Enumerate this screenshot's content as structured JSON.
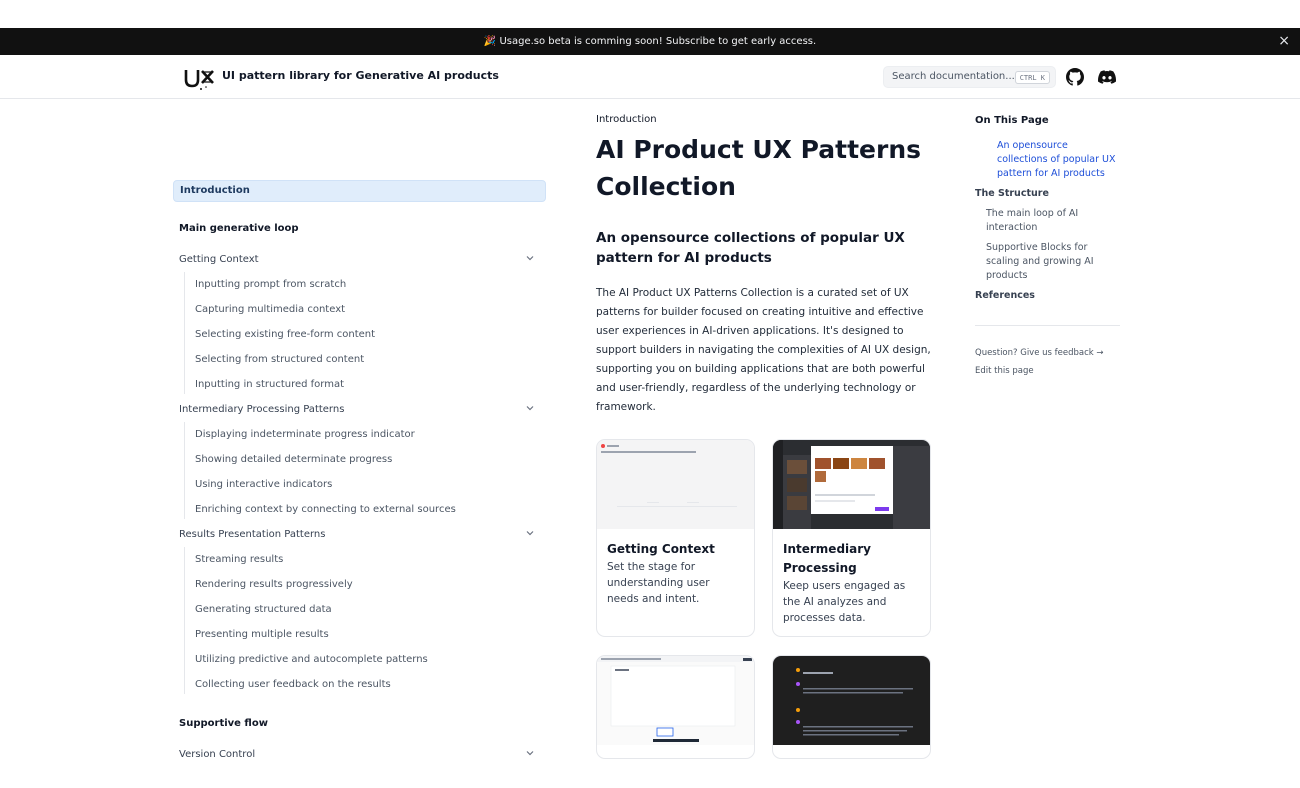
{
  "banner": {
    "text": "🎉 Usage.so beta is comming soon! Subscribe to get early access.",
    "close_label": "×"
  },
  "header": {
    "site_title": "UI pattern library for Generative AI products",
    "search_placeholder": "Search documentation...",
    "search_shortcut": "CTRL K",
    "icons": [
      "github-icon",
      "discord-icon"
    ]
  },
  "sidebar": {
    "active": "Introduction",
    "sections": [
      {
        "title": "Main generative loop",
        "groups": [
          {
            "label": "Getting Context",
            "items": [
              "Inputting prompt from scratch",
              "Capturing multimedia context",
              "Selecting existing free-form content",
              "Selecting from structured content",
              "Inputting in structured format"
            ]
          },
          {
            "label": "Intermediary Processing Patterns",
            "items": [
              "Displaying indeterminate progress indicator",
              "Showing detailed determinate progress",
              "Using interactive indicators",
              "Enriching context by connecting to external sources"
            ]
          },
          {
            "label": "Results Presentation Patterns",
            "items": [
              "Streaming results",
              "Rendering results progressively",
              "Generating structured data",
              "Presenting multiple results",
              "Utilizing predictive and autocomplete patterns",
              "Collecting user feedback on the results"
            ]
          }
        ]
      },
      {
        "title": "Supportive flow",
        "groups": [
          {
            "label": "Version Control",
            "items": []
          }
        ]
      }
    ]
  },
  "main": {
    "breadcrumb": "Introduction",
    "title": "AI Product UX Patterns Collection",
    "subtitle": "An opensource collections of popular UX pattern for AI products",
    "paragraph": "The AI Product UX Patterns Collection is a curated set of UX patterns for builder focused on creating intuitive and effective user experiences in AI-driven applications. It's designed to support builders in navigating the complexities of AI UX design, supporting you on building applications that are both powerful and user-friendly, regardless of the underlying technology or framework.",
    "cards": [
      {
        "title": "Getting Context",
        "description": "Set the stage for understanding user needs and intent."
      },
      {
        "title": "Intermediary Processing",
        "description": "Keep users engaged as the AI analyzes and processes data."
      }
    ]
  },
  "toc": {
    "heading": "On This Page",
    "items": [
      "An opensource collections of popular UX pattern for AI products",
      "The Structure",
      "The main loop of AI interaction",
      "Supportive Blocks for scaling and growing AI products",
      "References"
    ],
    "feedback": "Question? Give us feedback →",
    "edit": "Edit this page"
  },
  "colors": {
    "accent": "#1d4ed8",
    "banner_bg": "#111111",
    "active_bg": "#e0edfb"
  }
}
